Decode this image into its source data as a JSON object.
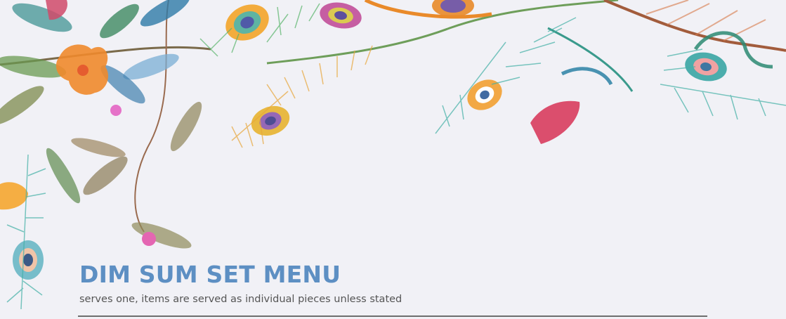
{
  "menu": {
    "title": "DIM SUM SET MENU",
    "subtitle": "serves one, items are served as individual pieces unless stated"
  },
  "colors": {
    "background": "#f1f1f6",
    "title": "#5d8fc3",
    "subtitle": "#555555",
    "rule": "#6d6d6d"
  }
}
